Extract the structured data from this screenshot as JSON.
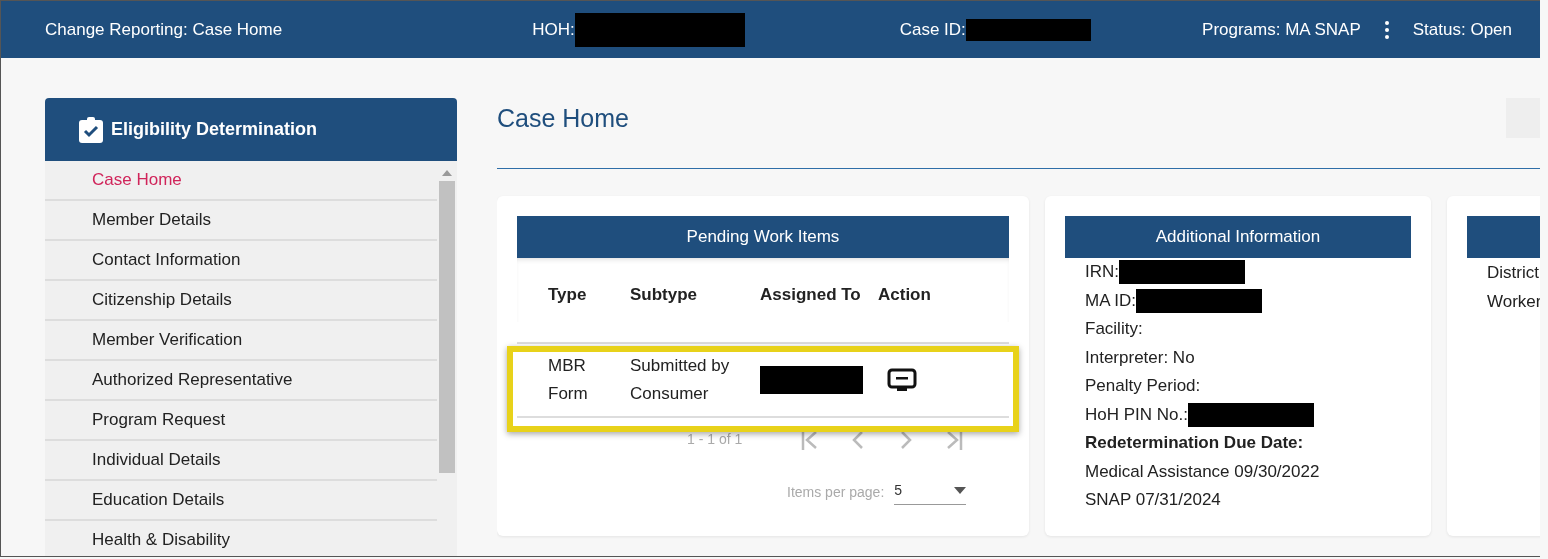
{
  "header": {
    "title": "Change Reporting: Case Home",
    "fields": [
      {
        "label": "HOH:",
        "redacted": true
      },
      {
        "label": "Case ID:",
        "redacted": true
      }
    ],
    "programs": "Programs: MA SNAP",
    "status": "Status: Open"
  },
  "sidebar": {
    "title": "Eligibility Determination",
    "items": [
      {
        "label": "Case Home",
        "selected": true
      },
      {
        "label": "Member Details",
        "selected": false
      },
      {
        "label": "Contact Information",
        "selected": false
      },
      {
        "label": "Citizenship Details",
        "selected": false
      },
      {
        "label": "Member Verification",
        "selected": false
      },
      {
        "label": "Authorized Representative",
        "selected": false
      },
      {
        "label": "Program Request",
        "selected": false
      },
      {
        "label": "Individual Details",
        "selected": false
      },
      {
        "label": "Education Details",
        "selected": false
      },
      {
        "label": "Health & Disability",
        "selected": false
      }
    ]
  },
  "page_title": "Case Home",
  "work_items": {
    "title": "Pending Work Items",
    "columns": [
      "Type",
      "Subtype",
      "Assigned To",
      "Action"
    ],
    "rows": [
      {
        "type": "MBR Form",
        "subtype": "Submitted by Consumer",
        "assigned_redacted": true,
        "highlighted": true
      }
    ],
    "range": "1 - 1 of 1",
    "items_per_page_label": "Items per page:",
    "items_per_page": "5"
  },
  "additional_info": {
    "title": "Additional Information",
    "lines": [
      {
        "kind": "field",
        "text": "IRN:",
        "redacted": true
      },
      {
        "kind": "field",
        "text": "MA ID:",
        "redacted": true
      },
      {
        "kind": "field",
        "text": "Facility:",
        "redacted": false
      },
      {
        "kind": "field",
        "text": "Interpreter: No",
        "redacted": false
      },
      {
        "kind": "field",
        "text": "Penalty Period:",
        "redacted": false
      },
      {
        "kind": "field",
        "text": "HoH PIN No.:",
        "redacted": true
      },
      {
        "kind": "heading",
        "text": "Redetermination Due Date:",
        "redacted": false
      },
      {
        "kind": "field",
        "text": "Medical Assistance 09/30/2022",
        "redacted": false
      },
      {
        "kind": "field",
        "text": "SNAP 07/31/2024",
        "redacted": false
      }
    ]
  },
  "third_card": {
    "lines": [
      "District",
      "Worker"
    ]
  }
}
